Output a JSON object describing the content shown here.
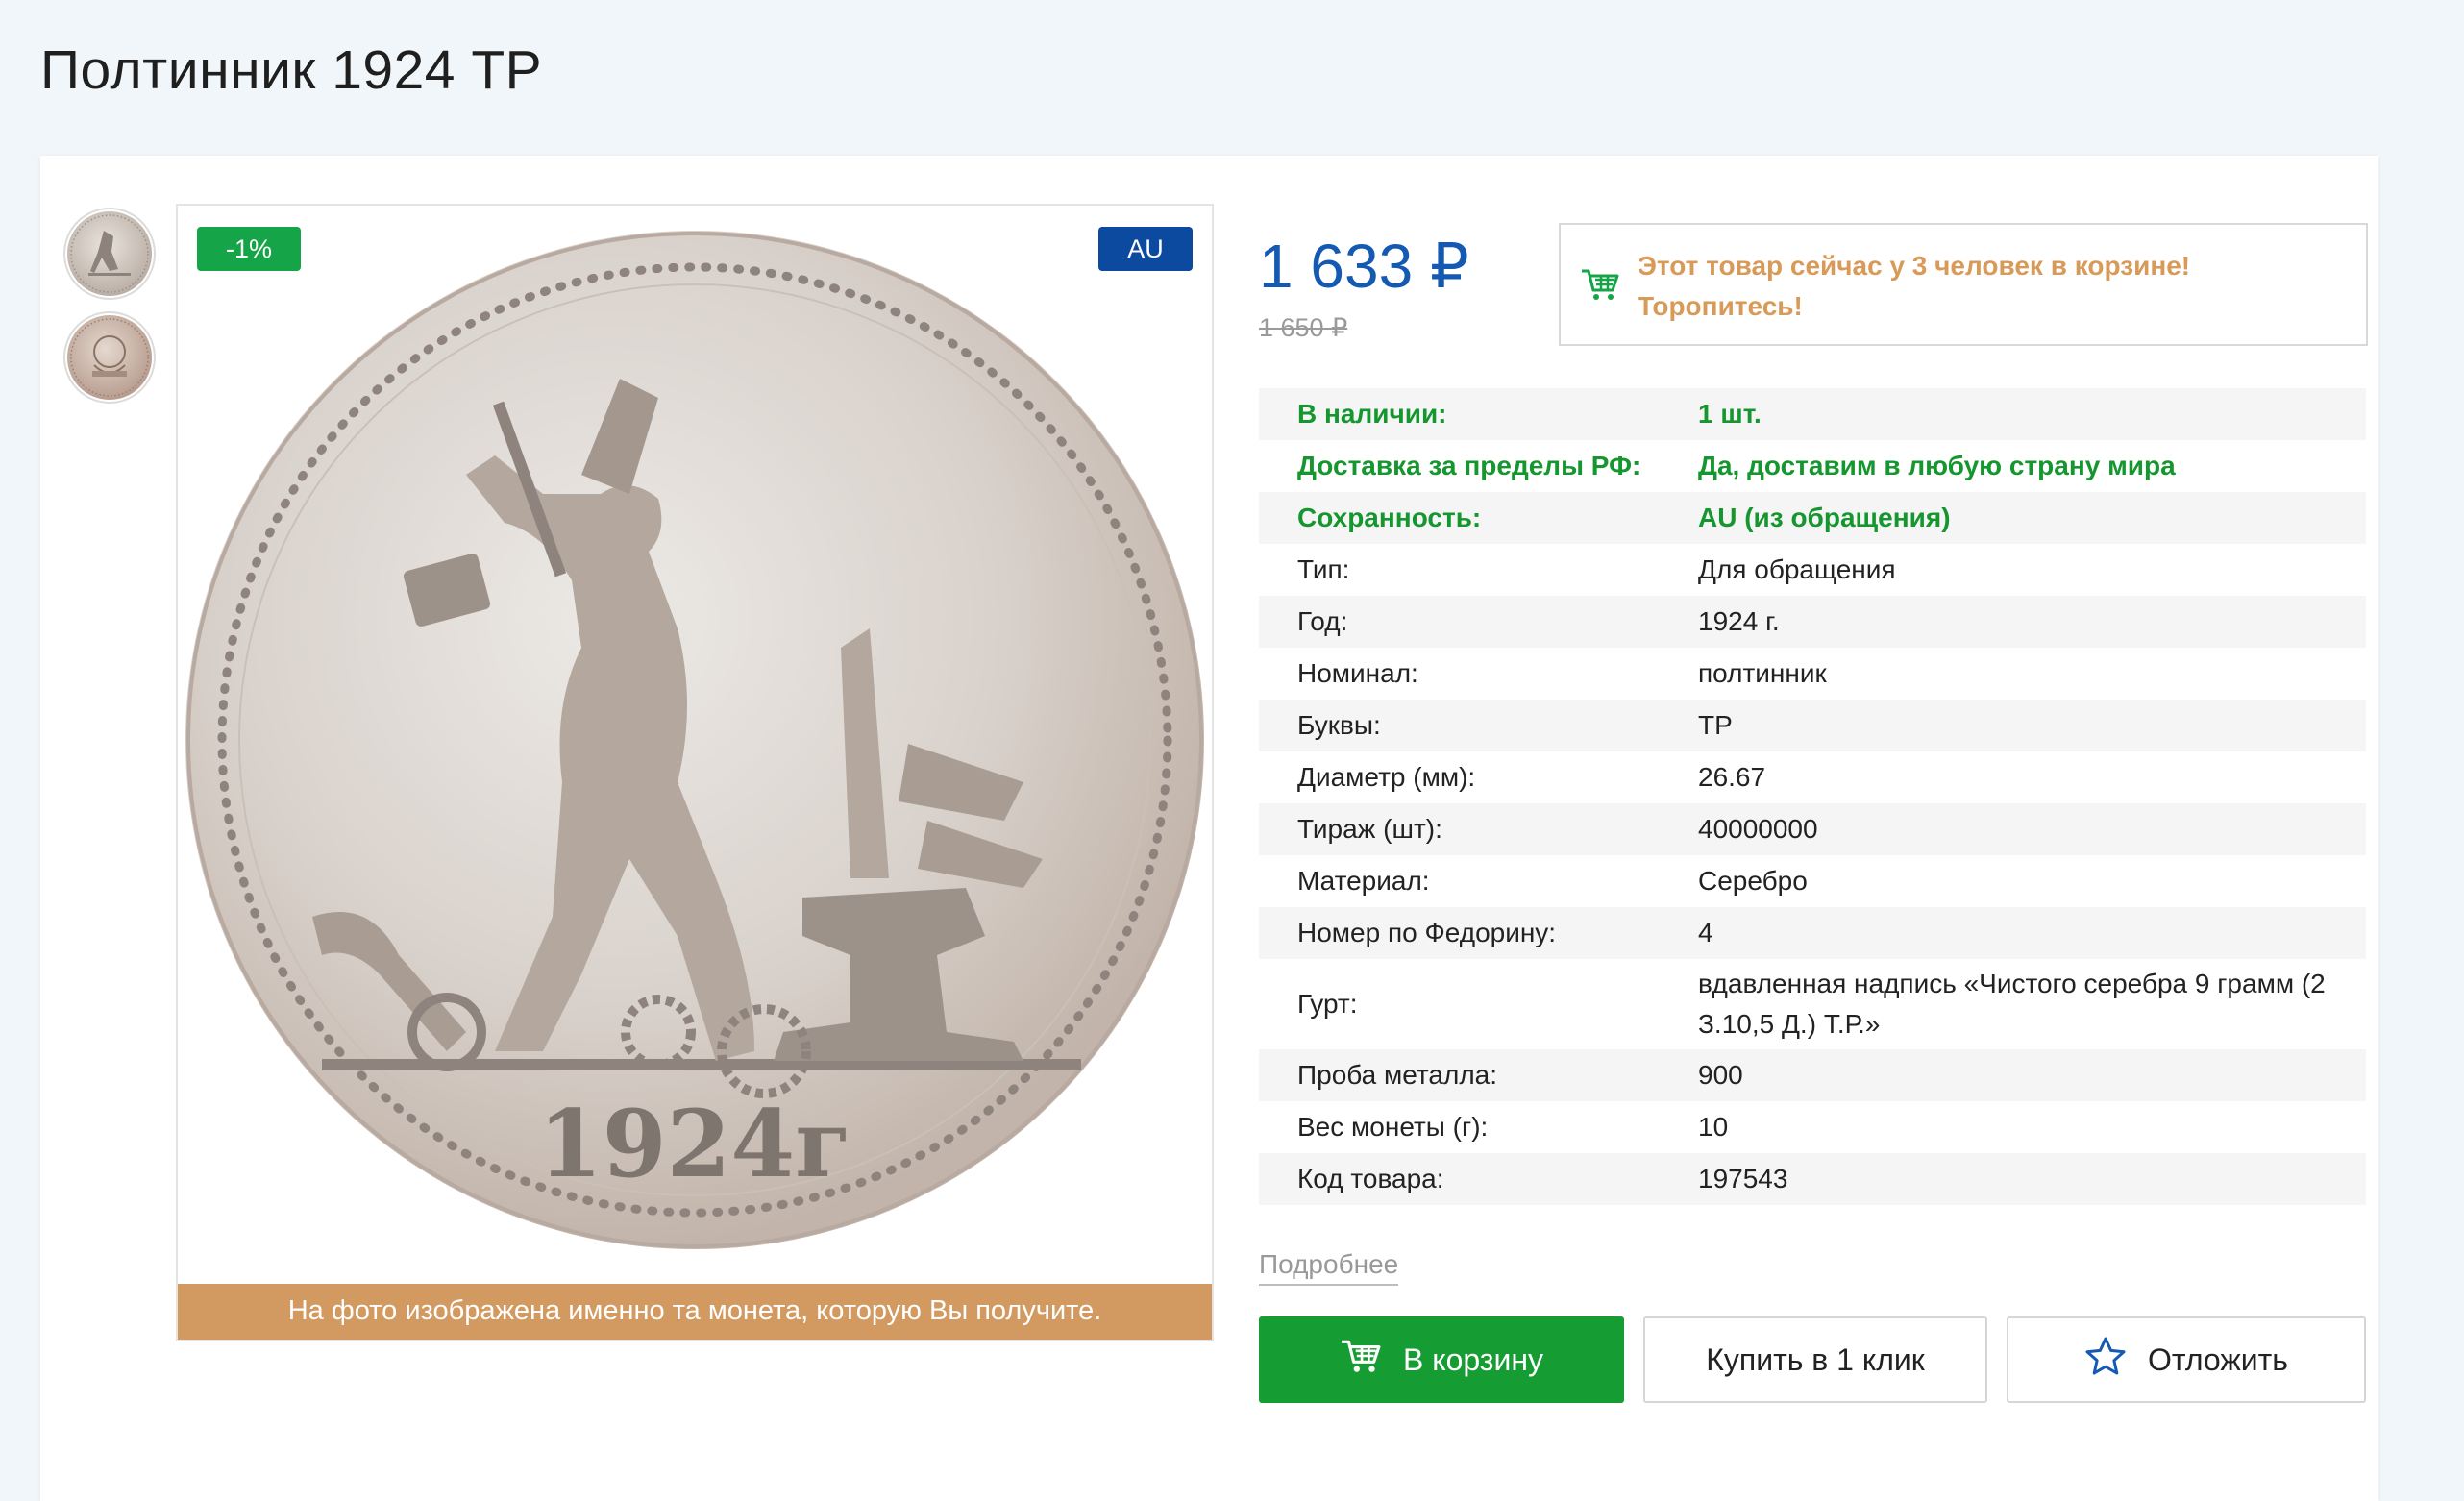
{
  "page": {
    "title": "Полтинник 1924 ТР"
  },
  "gallery": {
    "thumbnails": [
      "obverse-thumbnail",
      "reverse-thumbnail"
    ],
    "badge_discount": "-1%",
    "badge_grade": "AU",
    "photo_note": "На фото изображена именно та монета, которую Вы получите."
  },
  "pricing": {
    "price": "1 633 ₽",
    "old_price": "1 650 ₽"
  },
  "cart_notice": {
    "icon": "cart-icon",
    "text": "Этот товар сейчас у 3 человек в корзине! Торопитесь!"
  },
  "specs": [
    {
      "key": "В наличии:",
      "value": "1 шт.",
      "highlight": true
    },
    {
      "key": "Доставка за пределы РФ:",
      "value": "Да, доставим в любую страну мира",
      "highlight": true
    },
    {
      "key": "Сохранность:",
      "value": "AU (из обращения)",
      "highlight": true
    },
    {
      "key": "Тип:",
      "value": "Для обращения"
    },
    {
      "key": "Год:",
      "value": "1924 г."
    },
    {
      "key": "Номинал:",
      "value": "полтинник"
    },
    {
      "key": "Буквы:",
      "value": "ТР"
    },
    {
      "key": "Диаметр (мм):",
      "value": "26.67"
    },
    {
      "key": "Тираж (шт):",
      "value": "40000000"
    },
    {
      "key": "Материал:",
      "value": "Серебро"
    },
    {
      "key": "Номер по Федорину:",
      "value": "4"
    },
    {
      "key": "Гурт:",
      "value": "вдавленная надпись «Чистого серебра 9 грамм (2 З.10,5 Д.) Т.Р.»"
    },
    {
      "key": "Проба металла:",
      "value": "900"
    },
    {
      "key": "Вес монеты (г):",
      "value": "10"
    },
    {
      "key": "Код товара:",
      "value": "197543"
    }
  ],
  "more_link": "Подробнее",
  "buttons": {
    "cart": "В корзину",
    "one_click": "Купить в 1 клик",
    "save": "Отложить"
  },
  "colors": {
    "price": "#1459b2",
    "green": "#15962f",
    "accent_orange": "#d29a60",
    "badge_blue": "#0b4a9f"
  }
}
